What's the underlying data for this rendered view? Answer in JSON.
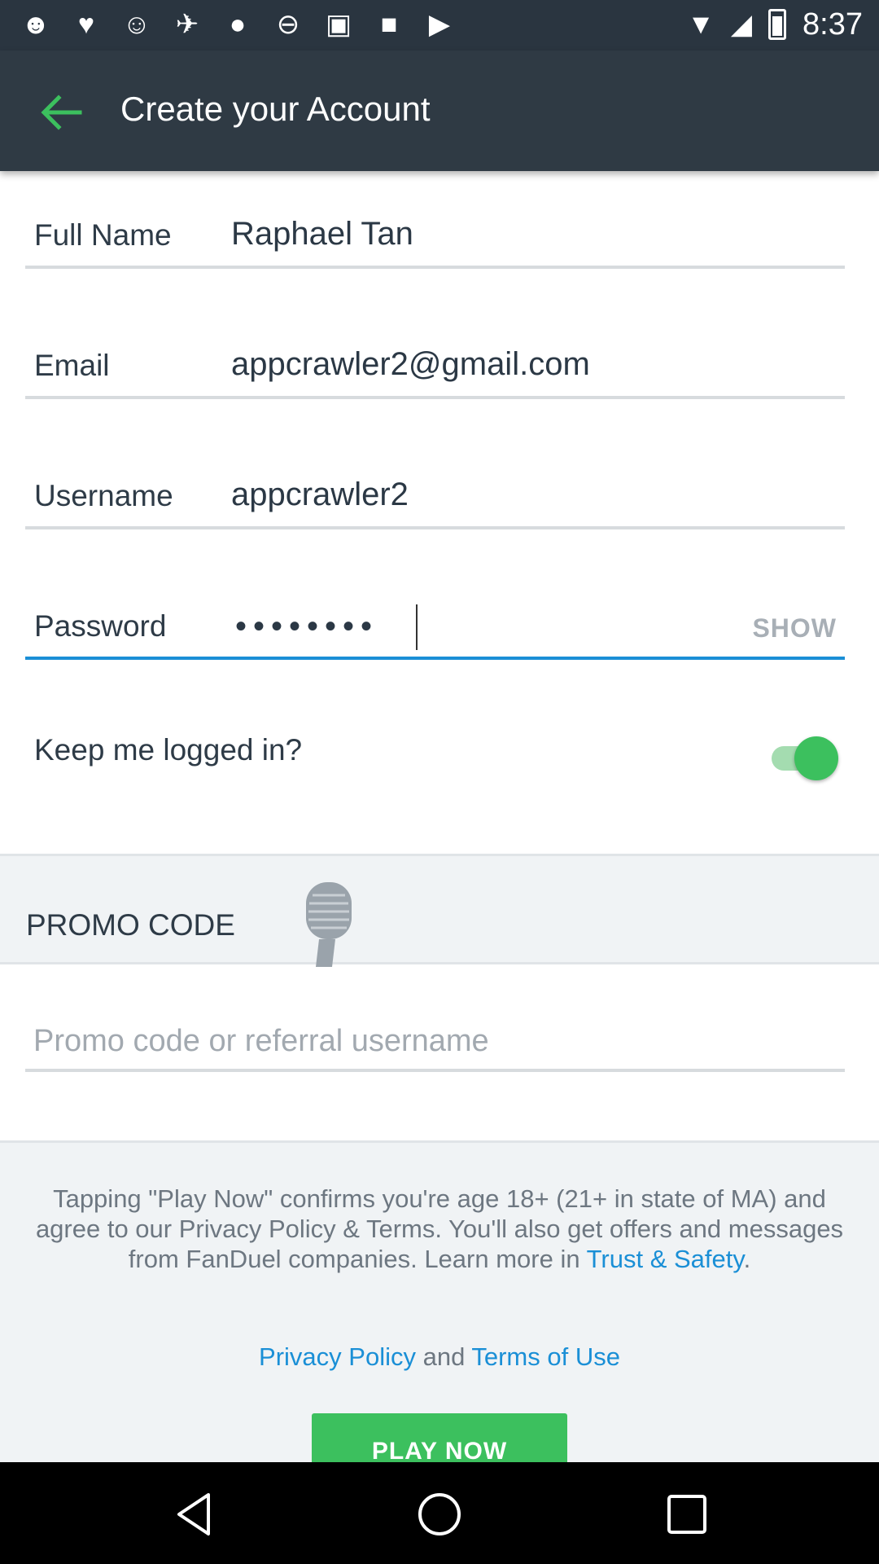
{
  "status_bar": {
    "time": "8:37",
    "left_icons": [
      "app-icon",
      "heart-icon",
      "chat-icon",
      "tracker-icon",
      "bulb-icon",
      "dnd-icon",
      "lock-icon",
      "briefcase-icon",
      "play-store-icon"
    ]
  },
  "app_bar": {
    "title": "Create your Account"
  },
  "form": {
    "full_name": {
      "label": "Full Name",
      "value": "Raphael Tan"
    },
    "email": {
      "label": "Email",
      "value": "appcrawler2@gmail.com"
    },
    "username": {
      "label": "Username",
      "value": "appcrawler2"
    },
    "password": {
      "label": "Password",
      "masked": "••••••••",
      "show_label": "SHOW"
    },
    "keep_logged_in": {
      "label": "Keep me logged in?",
      "checked": true
    }
  },
  "promo": {
    "title": "PROMO CODE",
    "placeholder": "Promo code or referral username"
  },
  "disclaimer": {
    "text": "Tapping \"Play Now\" confirms you're age 18+ (21+ in state of MA) and agree to our Privacy Policy & Terms. You'll also get offers and messages from FanDuel companies. Learn more in ",
    "link": "Trust & Safety",
    "end": ".",
    "privacy_link": "Privacy Policy",
    "and": " and ",
    "terms_link": "Terms of Use"
  },
  "play_button": {
    "label": "PLAY NOW"
  },
  "colors": {
    "app_bar": "#2f3a44",
    "accent_green": "#3cc05e",
    "link_blue": "#1a8fd6"
  }
}
